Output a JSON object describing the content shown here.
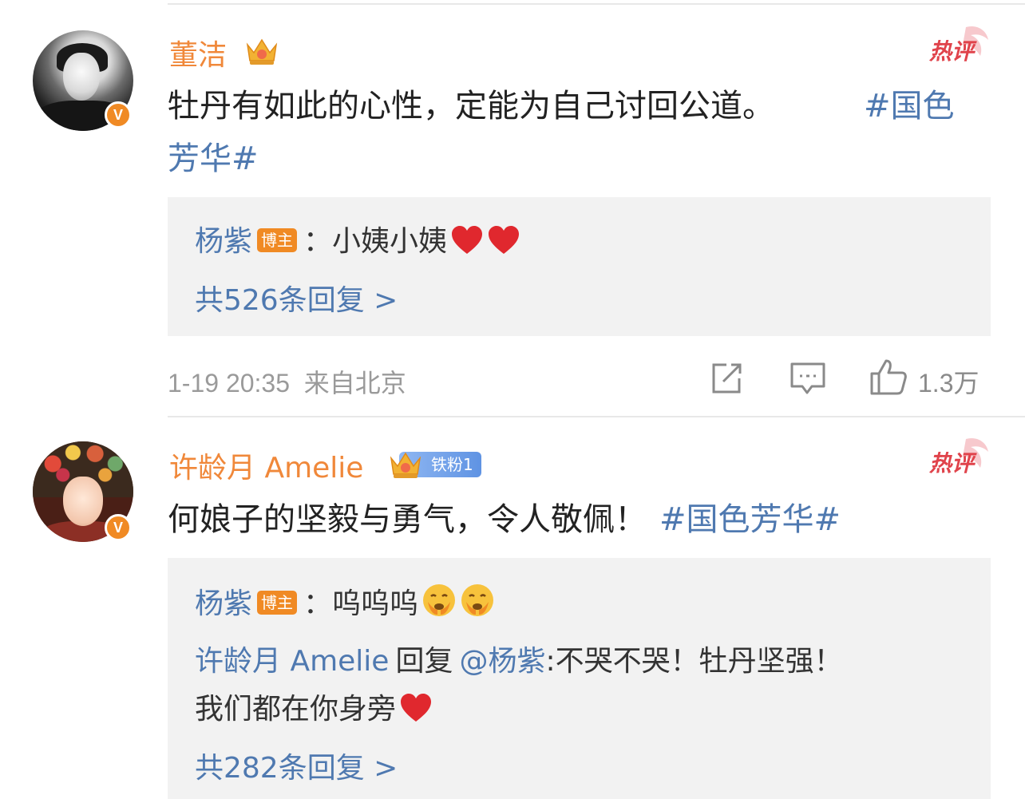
{
  "comments": [
    {
      "username": "董洁",
      "verified_mark": "V",
      "hot_label": "热评",
      "text": "牡丹有如此的心性，定能为自己讨回公道。",
      "topic": "#国色芳华#",
      "replies": [
        {
          "author": "杨紫",
          "author_badge": "博主",
          "separator": "：",
          "text": "小姨小姨"
        }
      ],
      "more_replies": "共526条回复 >",
      "time": "1-19 20:35",
      "source": "来自北京",
      "likes": "1.3万"
    },
    {
      "username": "许龄月 Amelie",
      "verified_mark": "V",
      "fan_badge": "铁粉1",
      "hot_label": "热评",
      "text": "何娘子的坚毅与勇气，令人敬佩！",
      "topic": "#国色芳华#",
      "replies": [
        {
          "author": "杨紫",
          "author_badge": "博主",
          "separator": "：",
          "text": "呜呜呜"
        },
        {
          "author": "许龄月 Amelie",
          "verb": "回复",
          "mention": "@杨紫",
          "text_line1": ":不哭不哭！牡丹坚强！",
          "text_line2": "我们都在你身旁"
        }
      ],
      "more_replies": "共282条回复 >"
    }
  ],
  "icons": {
    "crown": "crown-icon",
    "repost": "repost-icon",
    "comment": "comment-icon",
    "like": "like-icon",
    "heart": "heart-emoji",
    "cry": "cry-emoji"
  },
  "colors": {
    "username": "#f0883a",
    "topic": "#4f79b0",
    "hot": "#e0434b",
    "reply_bg": "#f2f2f2",
    "badge_orange": "#f08a24",
    "iron_fan": "#6a9be6"
  }
}
